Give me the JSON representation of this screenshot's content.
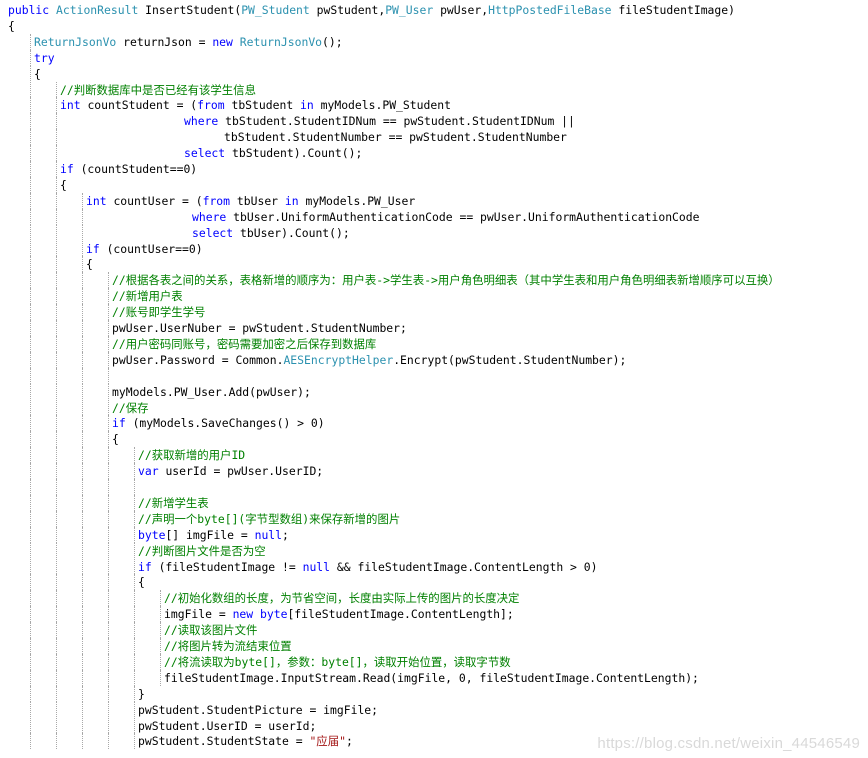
{
  "editor": {
    "lines": [
      {
        "indent": 0,
        "tokens": [
          {
            "t": "public ",
            "c": "kw"
          },
          {
            "t": "ActionResult ",
            "c": "ty"
          },
          {
            "t": "InsertStudent("
          },
          {
            "t": "PW_Student ",
            "c": "ty"
          },
          {
            "t": "pwStudent,"
          },
          {
            "t": "PW_User ",
            "c": "ty"
          },
          {
            "t": "pwUser,"
          },
          {
            "t": "HttpPostedFileBase ",
            "c": "ty"
          },
          {
            "t": "fileStudentImage)"
          }
        ]
      },
      {
        "indent": 0,
        "tokens": [
          {
            "t": "{"
          }
        ]
      },
      {
        "indent": 1,
        "tokens": [
          {
            "t": "ReturnJsonVo ",
            "c": "ty"
          },
          {
            "t": "returnJson = "
          },
          {
            "t": "new ",
            "c": "kw"
          },
          {
            "t": "ReturnJsonVo",
            "c": "ty"
          },
          {
            "t": "();"
          }
        ]
      },
      {
        "indent": 1,
        "tokens": [
          {
            "t": "try",
            "c": "kw"
          }
        ]
      },
      {
        "indent": 1,
        "tokens": [
          {
            "t": "{"
          }
        ]
      },
      {
        "indent": 2,
        "tokens": [
          {
            "t": "//判断数据库中是否已经有该学生信息",
            "c": "cm"
          }
        ]
      },
      {
        "indent": 2,
        "tokens": [
          {
            "t": "int ",
            "c": "kw"
          },
          {
            "t": "countStudent = ("
          },
          {
            "t": "from ",
            "c": "kw"
          },
          {
            "t": "tbStudent "
          },
          {
            "t": "in ",
            "c": "kw"
          },
          {
            "t": "myModels.PW_Student"
          }
        ]
      },
      {
        "indent": 2,
        "pad": 124,
        "tokens": [
          {
            "t": "where ",
            "c": "kw"
          },
          {
            "t": "tbStudent.StudentIDNum == pwStudent.StudentIDNum ||"
          }
        ]
      },
      {
        "indent": 2,
        "pad": 164,
        "tokens": [
          {
            "t": "tbStudent.StudentNumber == pwStudent.StudentNumber"
          }
        ]
      },
      {
        "indent": 2,
        "pad": 124,
        "tokens": [
          {
            "t": "select ",
            "c": "kw"
          },
          {
            "t": "tbStudent).Count();"
          }
        ]
      },
      {
        "indent": 2,
        "tokens": [
          {
            "t": "if ",
            "c": "kw"
          },
          {
            "t": "(countStudent==0)"
          }
        ]
      },
      {
        "indent": 2,
        "tokens": [
          {
            "t": "{"
          }
        ]
      },
      {
        "indent": 3,
        "tokens": [
          {
            "t": "int ",
            "c": "kw"
          },
          {
            "t": "countUser = ("
          },
          {
            "t": "from ",
            "c": "kw"
          },
          {
            "t": "tbUser "
          },
          {
            "t": "in ",
            "c": "kw"
          },
          {
            "t": "myModels.PW_User"
          }
        ]
      },
      {
        "indent": 3,
        "pad": 106,
        "tokens": [
          {
            "t": "where ",
            "c": "kw"
          },
          {
            "t": "tbUser.UniformAuthenticationCode == pwUser.UniformAuthenticationCode"
          }
        ]
      },
      {
        "indent": 3,
        "pad": 106,
        "tokens": [
          {
            "t": "select ",
            "c": "kw"
          },
          {
            "t": "tbUser).Count();"
          }
        ]
      },
      {
        "indent": 3,
        "tokens": [
          {
            "t": "if ",
            "c": "kw"
          },
          {
            "t": "(countUser==0)"
          }
        ]
      },
      {
        "indent": 3,
        "tokens": [
          {
            "t": "{"
          }
        ]
      },
      {
        "indent": 4,
        "tokens": [
          {
            "t": "//根据各表之间的关系，表格新增的顺序为：用户表->学生表->用户角色明细表（其中学生表和用户角色明细表新增顺序可以互换）",
            "c": "cm"
          }
        ]
      },
      {
        "indent": 4,
        "tokens": [
          {
            "t": "//新增用户表",
            "c": "cm"
          }
        ]
      },
      {
        "indent": 4,
        "tokens": [
          {
            "t": "//账号即学生学号",
            "c": "cm"
          }
        ]
      },
      {
        "indent": 4,
        "tokens": [
          {
            "t": "pwUser.UserNuber = pwStudent.StudentNumber;"
          }
        ]
      },
      {
        "indent": 4,
        "tokens": [
          {
            "t": "//用户密码同账号，密码需要加密之后保存到数据库",
            "c": "cm"
          }
        ]
      },
      {
        "indent": 4,
        "tokens": [
          {
            "t": "pwUser.Password = Common."
          },
          {
            "t": "AESEncryptHelper",
            "c": "ty"
          },
          {
            "t": ".Encrypt(pwStudent.StudentNumber);"
          }
        ]
      },
      {
        "indent": 4,
        "tokens": [
          {
            "t": ""
          }
        ]
      },
      {
        "indent": 4,
        "tokens": [
          {
            "t": "myModels.PW_User.Add(pwUser);"
          }
        ]
      },
      {
        "indent": 4,
        "tokens": [
          {
            "t": "//保存",
            "c": "cm"
          }
        ]
      },
      {
        "indent": 4,
        "tokens": [
          {
            "t": "if ",
            "c": "kw"
          },
          {
            "t": "(myModels.SaveChanges() > 0)"
          }
        ]
      },
      {
        "indent": 4,
        "tokens": [
          {
            "t": "{"
          }
        ]
      },
      {
        "indent": 5,
        "tokens": [
          {
            "t": "//获取新增的用户ID",
            "c": "cm"
          }
        ]
      },
      {
        "indent": 5,
        "tokens": [
          {
            "t": "var ",
            "c": "kw"
          },
          {
            "t": "userId = pwUser.UserID;"
          }
        ]
      },
      {
        "indent": 5,
        "tokens": [
          {
            "t": ""
          }
        ]
      },
      {
        "indent": 5,
        "tokens": [
          {
            "t": "//新增学生表",
            "c": "cm"
          }
        ]
      },
      {
        "indent": 5,
        "tokens": [
          {
            "t": "//声明一个byte[](字节型数组)来保存新增的图片",
            "c": "cm"
          }
        ]
      },
      {
        "indent": 5,
        "tokens": [
          {
            "t": "byte",
            "c": "kw"
          },
          {
            "t": "[] imgFile = "
          },
          {
            "t": "null",
            "c": "kw"
          },
          {
            "t": ";"
          }
        ]
      },
      {
        "indent": 5,
        "tokens": [
          {
            "t": "//判断图片文件是否为空",
            "c": "cm"
          }
        ]
      },
      {
        "indent": 5,
        "tokens": [
          {
            "t": "if ",
            "c": "kw"
          },
          {
            "t": "(fileStudentImage != "
          },
          {
            "t": "null ",
            "c": "kw"
          },
          {
            "t": "&& fileStudentImage.ContentLength > 0)"
          }
        ]
      },
      {
        "indent": 5,
        "tokens": [
          {
            "t": "{"
          }
        ]
      },
      {
        "indent": 6,
        "tokens": [
          {
            "t": "//初始化数组的长度，为节省空间，长度由实际上传的图片的长度决定",
            "c": "cm"
          }
        ]
      },
      {
        "indent": 6,
        "tokens": [
          {
            "t": "imgFile = "
          },
          {
            "t": "new ",
            "c": "kw"
          },
          {
            "t": "byte",
            "c": "kw"
          },
          {
            "t": "[fileStudentImage.ContentLength];"
          }
        ]
      },
      {
        "indent": 6,
        "tokens": [
          {
            "t": "//读取该图片文件",
            "c": "cm"
          }
        ]
      },
      {
        "indent": 6,
        "tokens": [
          {
            "t": "//将图片转为流结束位置",
            "c": "cm"
          }
        ]
      },
      {
        "indent": 6,
        "tokens": [
          {
            "t": "//将流读取为byte[]，参数：byte[]，读取开始位置，读取字节数",
            "c": "cm"
          }
        ]
      },
      {
        "indent": 6,
        "tokens": [
          {
            "t": "fileStudentImage.InputStream.Read(imgFile, 0, fileStudentImage.ContentLength);"
          }
        ]
      },
      {
        "indent": 5,
        "tokens": [
          {
            "t": "}"
          }
        ]
      },
      {
        "indent": 5,
        "tokens": [
          {
            "t": "pwStudent.StudentPicture = imgFile;"
          }
        ]
      },
      {
        "indent": 5,
        "tokens": [
          {
            "t": "pwStudent.UserID = userId;"
          }
        ]
      },
      {
        "indent": 5,
        "tokens": [
          {
            "t": "pwStudent.StudentState = "
          },
          {
            "t": "\"应届\"",
            "c": "st"
          },
          {
            "t": ";"
          }
        ]
      }
    ]
  },
  "watermark": "https://blog.csdn.net/weixin_44546549",
  "colors": {
    "keyword": "#0000ff",
    "type": "#2b91af",
    "comment": "#008000",
    "string": "#a31515",
    "text": "#000000"
  }
}
